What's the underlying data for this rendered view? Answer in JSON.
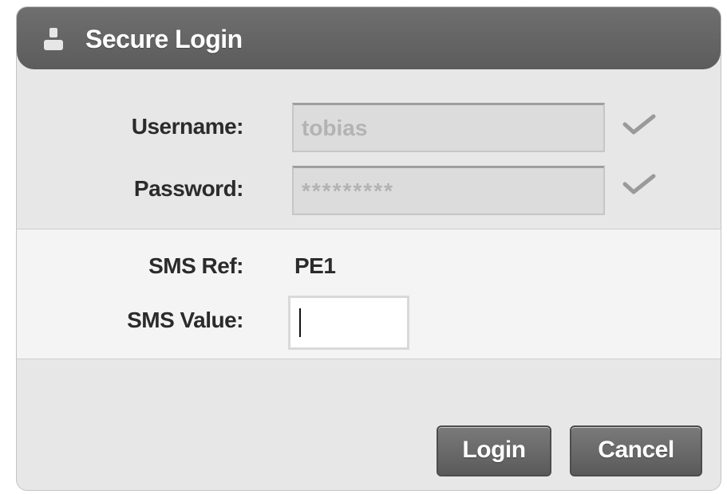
{
  "dialog": {
    "title": "Secure Login",
    "title_icon": "user-icon"
  },
  "form": {
    "username_label": "Username:",
    "username_value": "tobias",
    "password_label": "Password:",
    "password_value": "*********",
    "check_icon": "checkmark-icon",
    "sms_ref_label": "SMS Ref:",
    "sms_ref_value": "PE1",
    "sms_value_label": "SMS Value:",
    "sms_value": ""
  },
  "buttons": {
    "login": "Login",
    "cancel": "Cancel"
  },
  "colors": {
    "titlebar": "#5f5f5f",
    "dialog_bg": "#e7e7e7",
    "sms_band_bg": "#f4f4f4",
    "button_bg": "#666666"
  }
}
